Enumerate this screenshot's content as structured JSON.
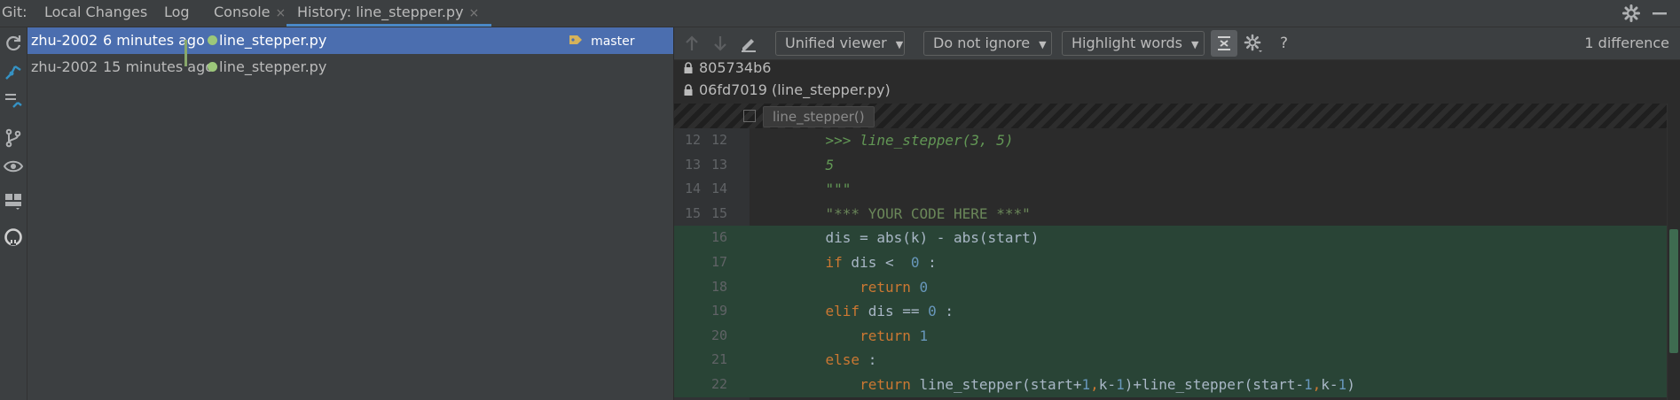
{
  "tabs": {
    "prefix": "Git:",
    "items": [
      {
        "label": "Local Changes"
      },
      {
        "label": "Log"
      },
      {
        "label": "Console",
        "closable": true
      },
      {
        "label": "History: line_stepper.py",
        "closable": true,
        "active": true
      }
    ],
    "close_glyph": "×"
  },
  "commits": [
    {
      "author": "zhu-2002",
      "time": "6 minutes ago",
      "file": "line_stepper.py",
      "branch": "master",
      "selected": true
    },
    {
      "author": "zhu-2002",
      "time": "15 minutes ago",
      "file": "line_stepper.py",
      "selected": false
    }
  ],
  "diff_toolbar": {
    "viewer": "Unified viewer",
    "ignore": "Do not ignore",
    "highlight": "Highlight words",
    "help": "?",
    "count": "1 difference"
  },
  "revisions": [
    {
      "label": "805734b6"
    },
    {
      "label": "06fd7019 (line_stepper.py)"
    }
  ],
  "fold": {
    "label": "line_stepper()"
  },
  "code_lines": [
    {
      "l1": "12",
      "l2": "12",
      "added": false,
      "parts": [
        {
          "t": "    "
        },
        {
          "t": ">>> line_stepper(3, 5)",
          "c": "doc"
        }
      ]
    },
    {
      "l1": "13",
      "l2": "13",
      "added": false,
      "parts": [
        {
          "t": "    "
        },
        {
          "t": "5",
          "c": "doc"
        }
      ]
    },
    {
      "l1": "14",
      "l2": "14",
      "added": false,
      "parts": [
        {
          "t": "    "
        },
        {
          "t": "\"\"\"",
          "c": "doc"
        }
      ]
    },
    {
      "l1": "15",
      "l2": "15",
      "added": false,
      "parts": [
        {
          "t": "    "
        },
        {
          "t": "\"*** YOUR CODE HERE ***\"",
          "c": "str"
        }
      ]
    },
    {
      "l1": "",
      "l2": "16",
      "added": true,
      "parts": [
        {
          "t": "    dis = abs(k) - abs(start)"
        }
      ]
    },
    {
      "l1": "",
      "l2": "17",
      "added": true,
      "parts": [
        {
          "t": "    "
        },
        {
          "t": "if",
          "c": "kw"
        },
        {
          "t": " dis <  "
        },
        {
          "t": "0",
          "c": "num"
        },
        {
          "t": " :"
        }
      ]
    },
    {
      "l1": "",
      "l2": "18",
      "added": true,
      "parts": [
        {
          "t": "        "
        },
        {
          "t": "return",
          "c": "kw"
        },
        {
          "t": " "
        },
        {
          "t": "0",
          "c": "num"
        }
      ]
    },
    {
      "l1": "",
      "l2": "19",
      "added": true,
      "parts": [
        {
          "t": "    "
        },
        {
          "t": "elif",
          "c": "kw"
        },
        {
          "t": " dis == "
        },
        {
          "t": "0",
          "c": "num"
        },
        {
          "t": " :"
        }
      ]
    },
    {
      "l1": "",
      "l2": "20",
      "added": true,
      "parts": [
        {
          "t": "        "
        },
        {
          "t": "return",
          "c": "kw"
        },
        {
          "t": " "
        },
        {
          "t": "1",
          "c": "num"
        }
      ]
    },
    {
      "l1": "",
      "l2": "21",
      "added": true,
      "parts": [
        {
          "t": "    "
        },
        {
          "t": "else",
          "c": "kw"
        },
        {
          "t": " :"
        }
      ]
    },
    {
      "l1": "",
      "l2": "22",
      "added": true,
      "parts": [
        {
          "t": "        "
        },
        {
          "t": "return",
          "c": "kw"
        },
        {
          "t": " line_stepper(start+"
        },
        {
          "t": "1",
          "c": "num"
        },
        {
          "t": ",",
          "c": "kw"
        },
        {
          "t": "k-"
        },
        {
          "t": "1",
          "c": "num"
        },
        {
          "t": ")+line_stepper(start-"
        },
        {
          "t": "1",
          "c": "num"
        },
        {
          "t": ",",
          "c": "kw"
        },
        {
          "t": "k-"
        },
        {
          "t": "1",
          "c": "num"
        },
        {
          "t": ")"
        }
      ]
    }
  ],
  "colors": {
    "accent": "#4a88c7",
    "selection": "#4b6eaf",
    "added_bg": "#294436",
    "graph": "#9cc77a"
  },
  "icons": [
    "refresh-icon",
    "cherry-pick-icon",
    "collapse-icon",
    "branch-icon",
    "eye-icon",
    "layout-icon",
    "github-icon",
    "gear-icon",
    "minimize-icon",
    "arrow-up-icon",
    "arrow-down-icon",
    "edit-icon",
    "collapse-unchanged-icon",
    "settings-icon",
    "lock-icon",
    "tag-icon"
  ]
}
